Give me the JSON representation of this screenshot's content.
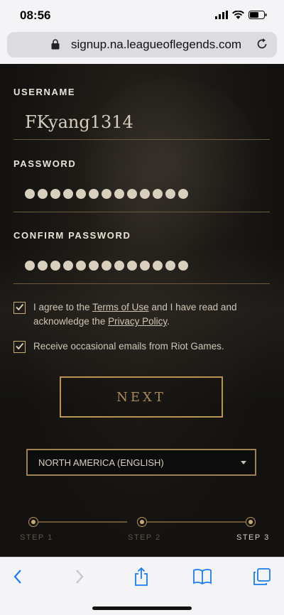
{
  "status_bar": {
    "time": "08:56"
  },
  "browser": {
    "url": "signup.na.leagueoflegends.com"
  },
  "form": {
    "username_label": "USERNAME",
    "username_value": "FKyang1314",
    "password_label": "PASSWORD",
    "password_mask_count": 13,
    "confirm_label": "CONFIRM PASSWORD",
    "confirm_mask_count": 13,
    "terms": {
      "part1": "I agree to the ",
      "terms_link": "Terms of Use",
      "part2": " and I have read and acknowledge the ",
      "privacy_link": "Privacy Policy",
      "part3": ".",
      "checked": true
    },
    "emails": {
      "text": "Receive occasional emails from Riot Games.",
      "checked": true
    },
    "next_label": "NEXT",
    "region_value": "NORTH AMERICA (ENGLISH)"
  },
  "stepper": {
    "steps": [
      "STEP 1",
      "STEP 2",
      "STEP 3"
    ],
    "current_step": 3
  },
  "toolbar": {
    "icons": [
      "back-icon",
      "forward-icon",
      "share-icon",
      "bookmarks-icon",
      "tabs-icon"
    ]
  },
  "colors": {
    "gold": "#c9aa71",
    "link_blue": "#1a7cf5",
    "background_dark": "#141311"
  }
}
